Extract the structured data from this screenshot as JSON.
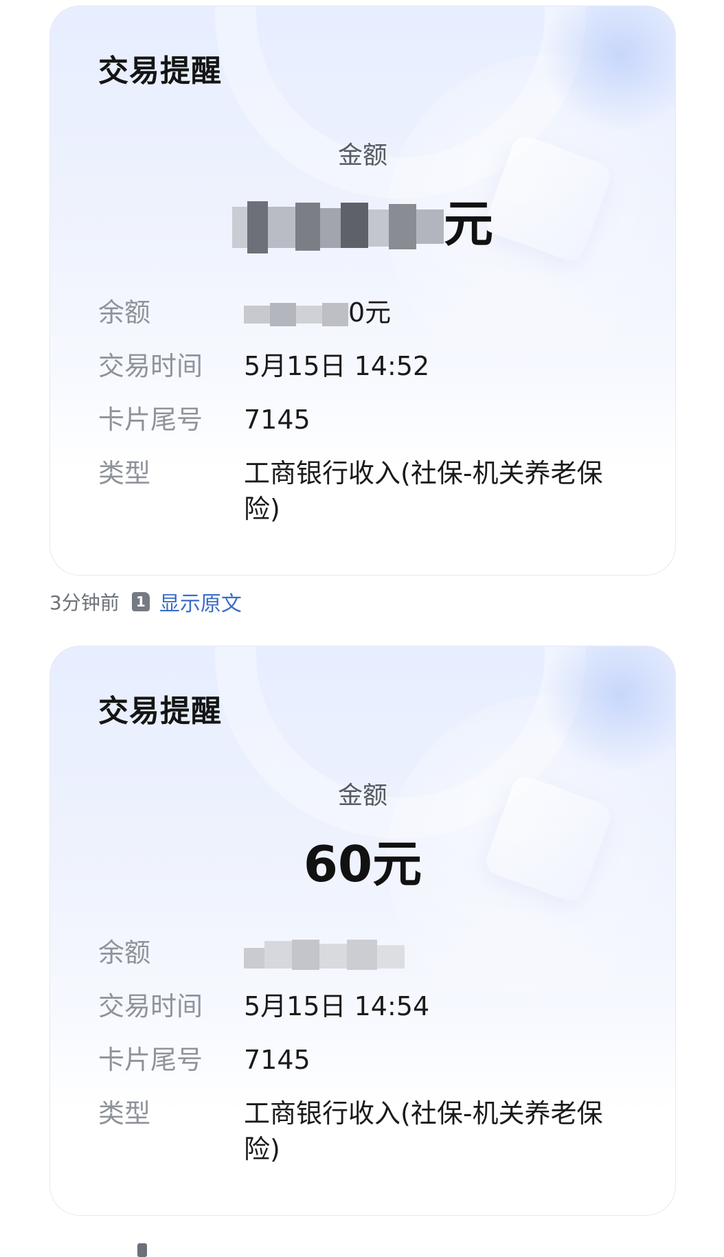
{
  "cards": [
    {
      "title": "交易提醒",
      "amount_label": "金额",
      "amount_suffix": "元",
      "balance_label": "余额",
      "balance_suffix": "0元",
      "time_label": "交易时间",
      "time_value": "5月15日 14:52",
      "card_label": "卡片尾号",
      "card_value": "7145",
      "type_label": "类型",
      "type_value": "工商银行收入(社保-机关养老保险)"
    },
    {
      "title": "交易提醒",
      "amount_label": "金额",
      "amount_value": "60元",
      "balance_label": "余额",
      "time_label": "交易时间",
      "time_value": "5月15日 14:54",
      "card_label": "卡片尾号",
      "card_value": "7145",
      "type_label": "类型",
      "type_value": "工商银行收入(社保-机关养老保险)"
    }
  ],
  "meta": {
    "time_ago": "3分钟前",
    "sim_badge": "1",
    "show_original": "显示原文"
  },
  "colors": {
    "card_gradient_top": "#e7eeff",
    "label_gray": "#8f939a",
    "link_blue": "#3a6cc8",
    "text_dark": "#111111"
  }
}
